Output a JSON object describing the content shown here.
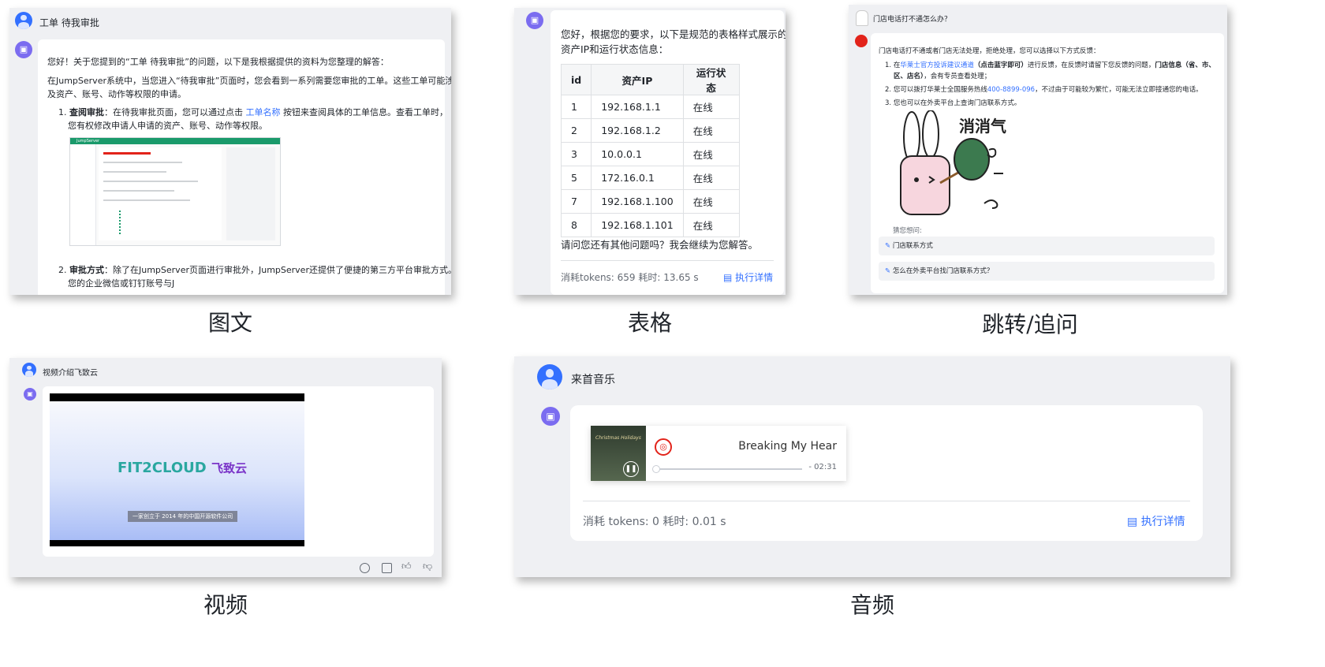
{
  "panels": {
    "image_text": {
      "question": "工单 待我审批",
      "intro": "您好！关于您提到的“工单 待我审批”的问题，以下是我根据提供的资料为您整理的解答：",
      "para1_line1": "在JumpServer系统中，当您进入“待我审批”页面时，您会看到一系列需要您审批的工单。这些工单可能涉",
      "para1_line2": "及资产、账号、动作等权限的申请。",
      "item1_num": "1.",
      "item1_bold": "查阅审批",
      "item1_a": "：在待我审批页面，您可以通过点击 ",
      "item1_link": "工单名称",
      "item1_b": " 按钮来查阅具体的工单信息。查看工单时，",
      "item1_line2": "您有权修改申请人申请的资产、账号、动作等权限。",
      "item2_num": "2.",
      "item2_bold": "审批方式",
      "item2_a": "：除了在JumpServer页面进行审批外，JumpServer还提供了便捷的第三方平台审批方式。当",
      "item2_line2": "您的企业微信或钉钉账号与J",
      "shot_brand": "JumpServer"
    },
    "table": {
      "intro_line1": "您好，根据您的要求，以下是规范的表格样式展示的",
      "intro_line2": "资产IP和运行状态信息：",
      "headers": [
        "id",
        "资产IP",
        "运行状态"
      ],
      "rows": [
        [
          "1",
          "192.168.1.1",
          "在线"
        ],
        [
          "2",
          "192.168.1.2",
          "在线"
        ],
        [
          "3",
          "10.0.0.1",
          "在线"
        ],
        [
          "5",
          "172.16.0.1",
          "在线"
        ],
        [
          "7",
          "192.168.1.100",
          "在线"
        ],
        [
          "8",
          "192.168.1.101",
          "在线"
        ]
      ],
      "outro": "请问您还有其他问题吗？我会继续为您解答。",
      "stats": "消耗tokens: 659  耗时: 13.65 s",
      "detail_link": "执行详情"
    },
    "jump": {
      "question": "门店电话打不通怎么办？",
      "intro": "门店电话打不通或者门店无法处理，拒绝处理，您可以选择以下方式反馈：",
      "item1_num": "1.",
      "item1_a": "在",
      "item1_link": "华莱士官方投诉建议通道",
      "item1_b": "（点击蓝字即可）",
      "item1_c": "进行反馈，在反馈时请留下您反馈的问题，",
      "item1_d": "门店信息（省、市、",
      "item1_line2_bold": "区、店名）",
      "item1_line2": "，会有专员查看处理；",
      "item2_num": "2.",
      "item2_a": "您可以拨打华莱士全国服务热线",
      "item2_link": "400-8899-096",
      "item2_b": "，不过由于可能较为繁忙，可能无法立即接通您的电话。",
      "item3_num": "3.",
      "item3": "您也可以在外卖平台上查询门店联系方式。",
      "sticker_text": "消消气",
      "guess_label": "猜您想问:",
      "suggestions": [
        "门店联系方式",
        "怎么在外卖平台找门店联系方式？"
      ]
    },
    "video": {
      "question": "视频介绍飞致云",
      "logo_latin": "FIT2CLOUD",
      "logo_cn": "飞致云",
      "tagline": "一家创立于 2014 年的中国开源软件公司"
    },
    "audio": {
      "question": "来首音乐",
      "track_title": "Breaking My Hear",
      "time": "- 02:31",
      "album_text": "Christmas Holidays",
      "progress": 0.0,
      "stats": "消耗 tokens: 0   耗时: 0.01 s",
      "detail_link": "执行详情"
    }
  },
  "captions": {
    "image_text": "图文",
    "table": "表格",
    "jump": "跳转/追问",
    "video": "视频",
    "audio": "音频"
  },
  "colors": {
    "accent": "#3370ff",
    "bot_avatar": "#7b6cf0",
    "netease_red": "#e2231a",
    "jumpserver_green": "#1a9a6b"
  }
}
